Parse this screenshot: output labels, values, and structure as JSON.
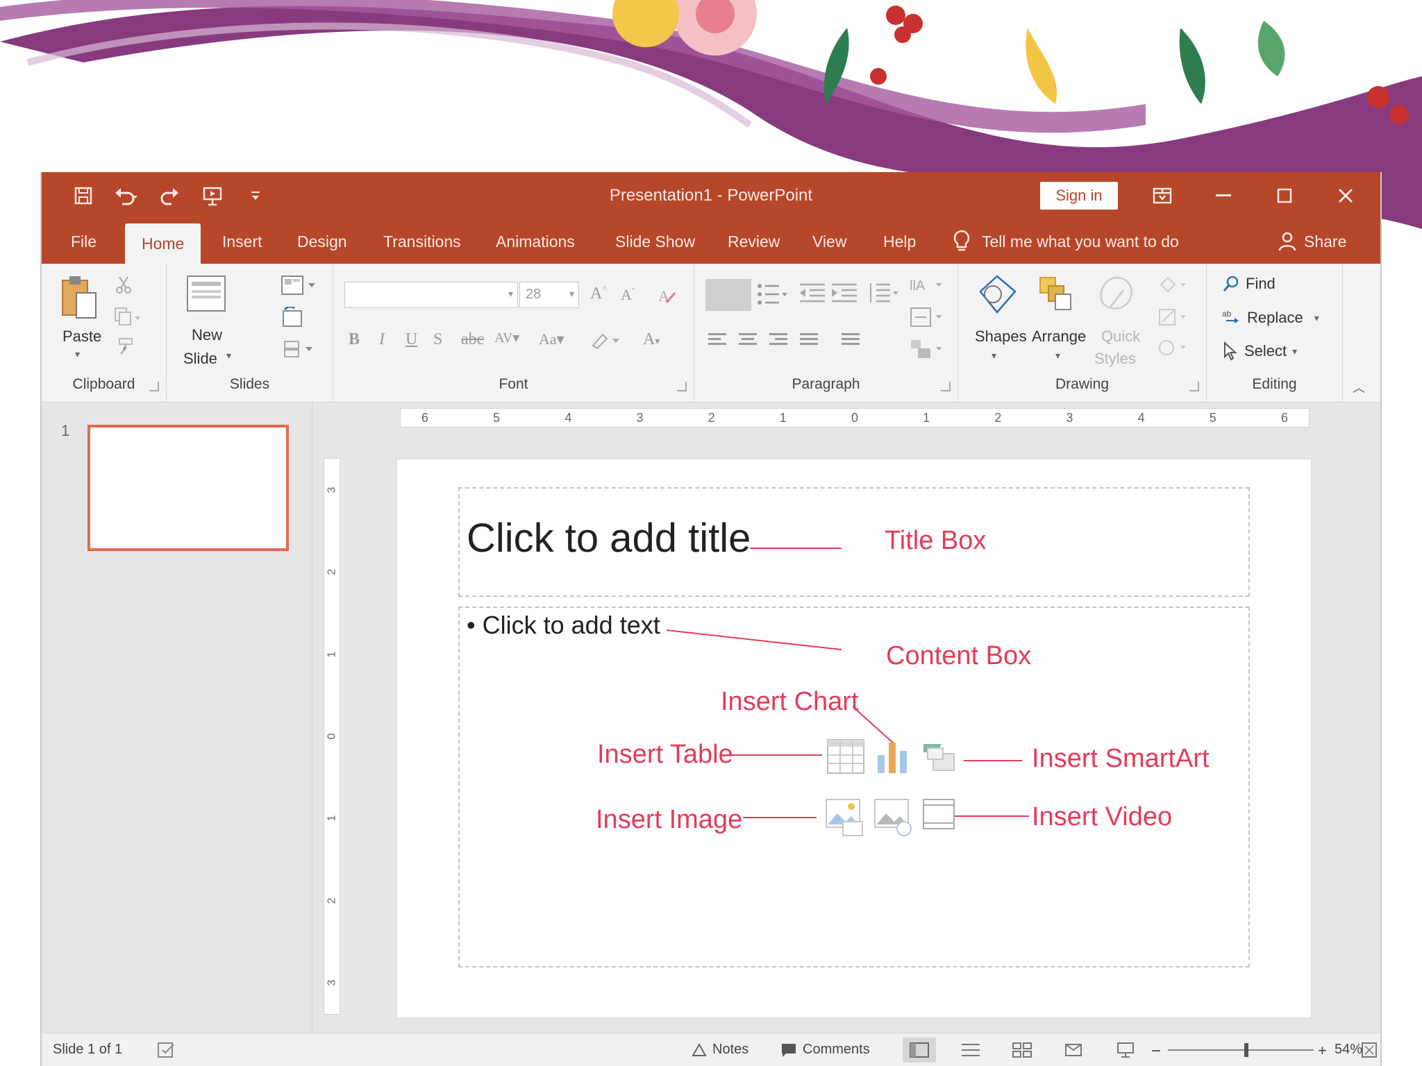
{
  "colors": {
    "accent": "#b7472a",
    "accent_text": "#fbe9e3",
    "annotation": "#e33b5a",
    "thumb_border": "#e36b4f"
  },
  "window": {
    "title": "Presentation1  -  PowerPoint",
    "sign_in": "Sign in",
    "quick_access_icons": [
      "save-icon",
      "undo-icon",
      "redo-icon",
      "start-from-beginning-icon",
      "customize-qat-icon"
    ],
    "window_controls": [
      "ribbon-display-options-icon",
      "minimize-icon",
      "maximize-icon",
      "close-icon"
    ]
  },
  "tabs": {
    "items": [
      "File",
      "Home",
      "Insert",
      "Design",
      "Transitions",
      "Animations",
      "Slide Show",
      "Review",
      "View",
      "Help"
    ],
    "active": "Home",
    "tell_me": "Tell me what you want to do",
    "share": "Share"
  },
  "ribbon": {
    "clipboard": {
      "label": "Clipboard",
      "paste": "Paste"
    },
    "slides": {
      "label": "Slides",
      "new_slide_line1": "New",
      "new_slide_line2": "Slide"
    },
    "font": {
      "label": "Font",
      "font_name": "",
      "font_size": "28"
    },
    "paragraph": {
      "label": "Paragraph"
    },
    "drawing": {
      "label": "Drawing",
      "shapes": "Shapes",
      "arrange": "Arrange",
      "quick_styles_line1": "Quick",
      "quick_styles_line2": "Styles"
    },
    "editing": {
      "label": "Editing",
      "find": "Find",
      "replace": "Replace",
      "select": "Select"
    }
  },
  "thumbnails": {
    "slide_number": "1"
  },
  "rulers": {
    "horizontal": [
      "6",
      "5",
      "4",
      "3",
      "2",
      "1",
      "0",
      "1",
      "2",
      "3",
      "4",
      "5",
      "6"
    ],
    "vertical": [
      "3",
      "2",
      "1",
      "0",
      "1",
      "2",
      "3"
    ]
  },
  "slide": {
    "title_placeholder": "Click to add title",
    "content_placeholder": "• Click to add text",
    "annotations": {
      "title_box": "Title Box",
      "content_box": "Content Box",
      "insert_chart": "Insert Chart",
      "insert_table": "Insert Table",
      "insert_smartart": "Insert SmartArt",
      "insert_image": "Insert Image",
      "insert_video": "Insert Video"
    }
  },
  "status": {
    "slide_info": "Slide 1 of 1",
    "notes": "Notes",
    "comments": "Comments",
    "zoom": "54%",
    "zoom_fraction": 0.54
  }
}
